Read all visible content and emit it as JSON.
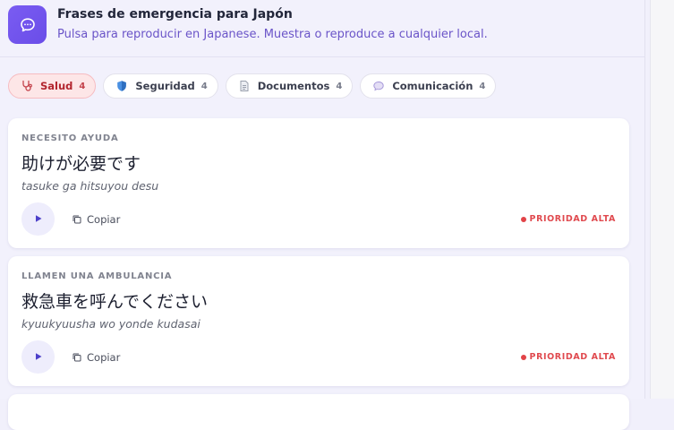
{
  "header": {
    "title": "Frases de emergencia para Japón",
    "subtitle": "Pulsa para reproducir en Japanese. Muestra o reproduce a cualquier local.",
    "icon": "chat-bubble-icon",
    "accent_color": "#7155f0"
  },
  "tabs": [
    {
      "label": "Salud",
      "count": "4",
      "icon": "stethoscope-icon",
      "active": true
    },
    {
      "label": "Seguridad",
      "count": "4",
      "icon": "shield-icon",
      "active": false
    },
    {
      "label": "Documentos",
      "count": "4",
      "icon": "document-icon",
      "active": false
    },
    {
      "label": "Comunicación",
      "count": "4",
      "icon": "speech-bubble-icon",
      "active": false
    }
  ],
  "phrases": [
    {
      "label": "NECESITO AYUDA",
      "native": "助けが必要です",
      "romaji": "tasuke ga hitsuyou desu",
      "copy_label": "Copiar",
      "priority": "PRIORIDAD ALTA",
      "priority_color": "#e24347"
    },
    {
      "label": "LLAMEN UNA AMBULANCIA",
      "native": "救急車を呼んでください",
      "romaji": "kyuukyuusha wo yonde kudasai",
      "copy_label": "Copiar",
      "priority": "PRIORIDAD ALTA",
      "priority_color": "#e24347"
    }
  ]
}
